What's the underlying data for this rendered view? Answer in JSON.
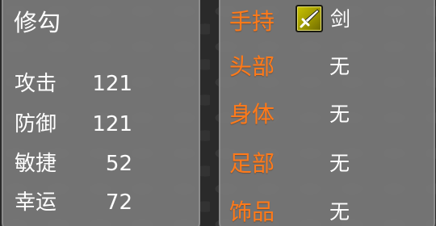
{
  "character": {
    "name": "修勾",
    "stats": [
      {
        "label": "攻击",
        "value": "121"
      },
      {
        "label": "防御",
        "value": "121"
      },
      {
        "label": "敏捷",
        "value": "52"
      },
      {
        "label": "幸运",
        "value": "72"
      }
    ]
  },
  "equipment": {
    "slots": [
      {
        "label": "手持",
        "value": "剑",
        "icon": "sword-icon"
      },
      {
        "label": "头部",
        "value": "无"
      },
      {
        "label": "身体",
        "value": "无"
      },
      {
        "label": "足部",
        "value": "无"
      },
      {
        "label": "饰品",
        "value": "无"
      }
    ]
  },
  "colors": {
    "slot_label": "#ff7a1a",
    "text": "#ffffff",
    "panel": "#787878",
    "item_icon_bg": "#b4ae00"
  }
}
